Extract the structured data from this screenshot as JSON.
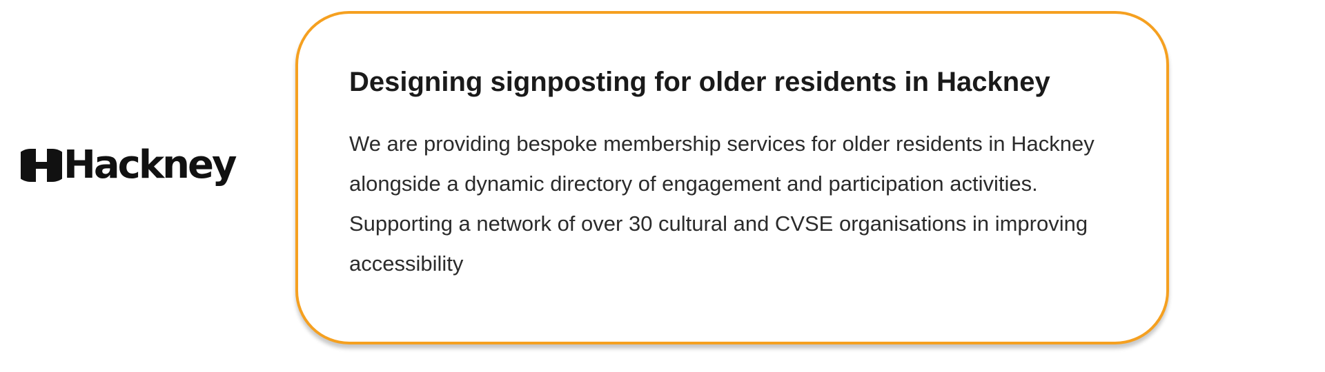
{
  "logo": {
    "wordmark": "Hackney",
    "icon": "hackney-h-logo-icon"
  },
  "card": {
    "title": "Designing signposting for older residents in Hackney",
    "body": "We are providing bespoke membership services for older residents in Hackney alongside a dynamic directory of engagement and participation activities. Supporting a network of over 30 cultural and CVSE organisations in improving accessibility",
    "border_color": "#f5a020"
  }
}
